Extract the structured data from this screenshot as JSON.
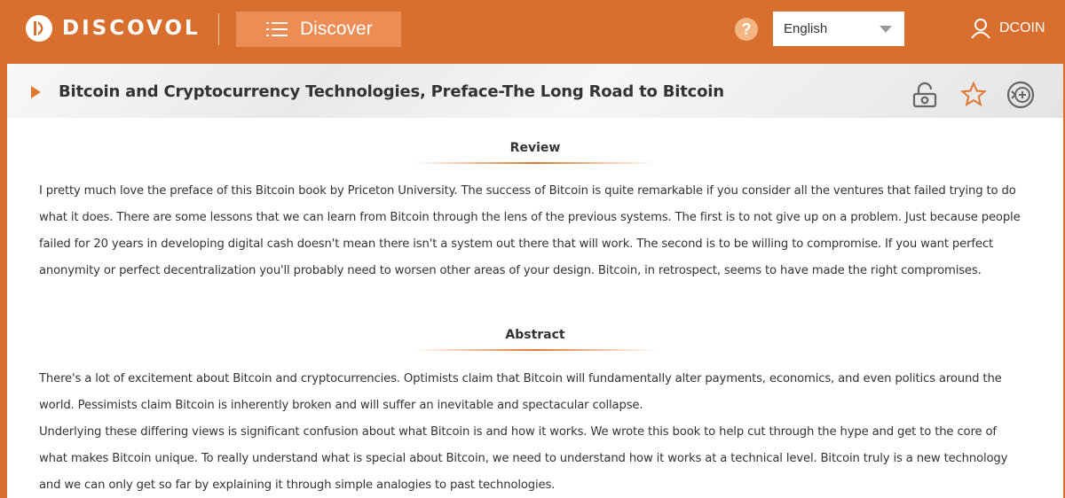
{
  "header": {
    "logo_text": "DISCOVOL",
    "discover_label": "Discover",
    "help_glyph": "?",
    "language": "English",
    "username": "DCOIN"
  },
  "colors": {
    "brand": "#d86f2e",
    "accent": "#e07832",
    "button": "#eb8d55"
  },
  "icons": [
    "logo-mark-icon",
    "list-icon",
    "help-icon",
    "chevron-down-icon",
    "user-icon",
    "chevron-right-icon",
    "open-access-icon",
    "star-icon",
    "add-icon"
  ],
  "article": {
    "title": "Bitcoin and Cryptocurrency Technologies, Preface-The Long Road to Bitcoin",
    "review_heading": "Review",
    "review_text": "I pretty much love the preface of this Bitcoin book by Priceton University. The success of Bitcoin is quite remarkable if you consider all the ventures that failed trying to do what it does. There are some lessons that we can learn from Bitcoin through the lens of the previous systems. The first is to not give up on a problem. Just because people failed for 20 years in developing digital cash doesn't mean there isn't a system out there that will work. The second is to be willing to compromise. If you want perfect anonymity or perfect decentralization you'll probably need to worsen other areas of your design. Bitcoin, in retrospect, seems to have made the right compromises.",
    "abstract_heading": "Abstract",
    "abstract_paragraphs": [
      "There's a lot of excitement about Bitcoin and cryptocurrencies. Optimists claim that Bitcoin will fundamentally alter payments, economics, and even politics around the world. Pessimists claim Bitcoin is inherently broken and will suffer an inevitable and spectacular collapse.",
      "Underlying these differing views is significant confusion about what Bitcoin is and how it works. We wrote this book to help cut through the hype and get to the core of what makes Bitcoin unique. To really understand what is special about Bitcoin, we need to understand how it works at a technical level. Bitcoin truly is a new technology and we can only get so far by explaining it through simple analogies to past technologies."
    ]
  }
}
